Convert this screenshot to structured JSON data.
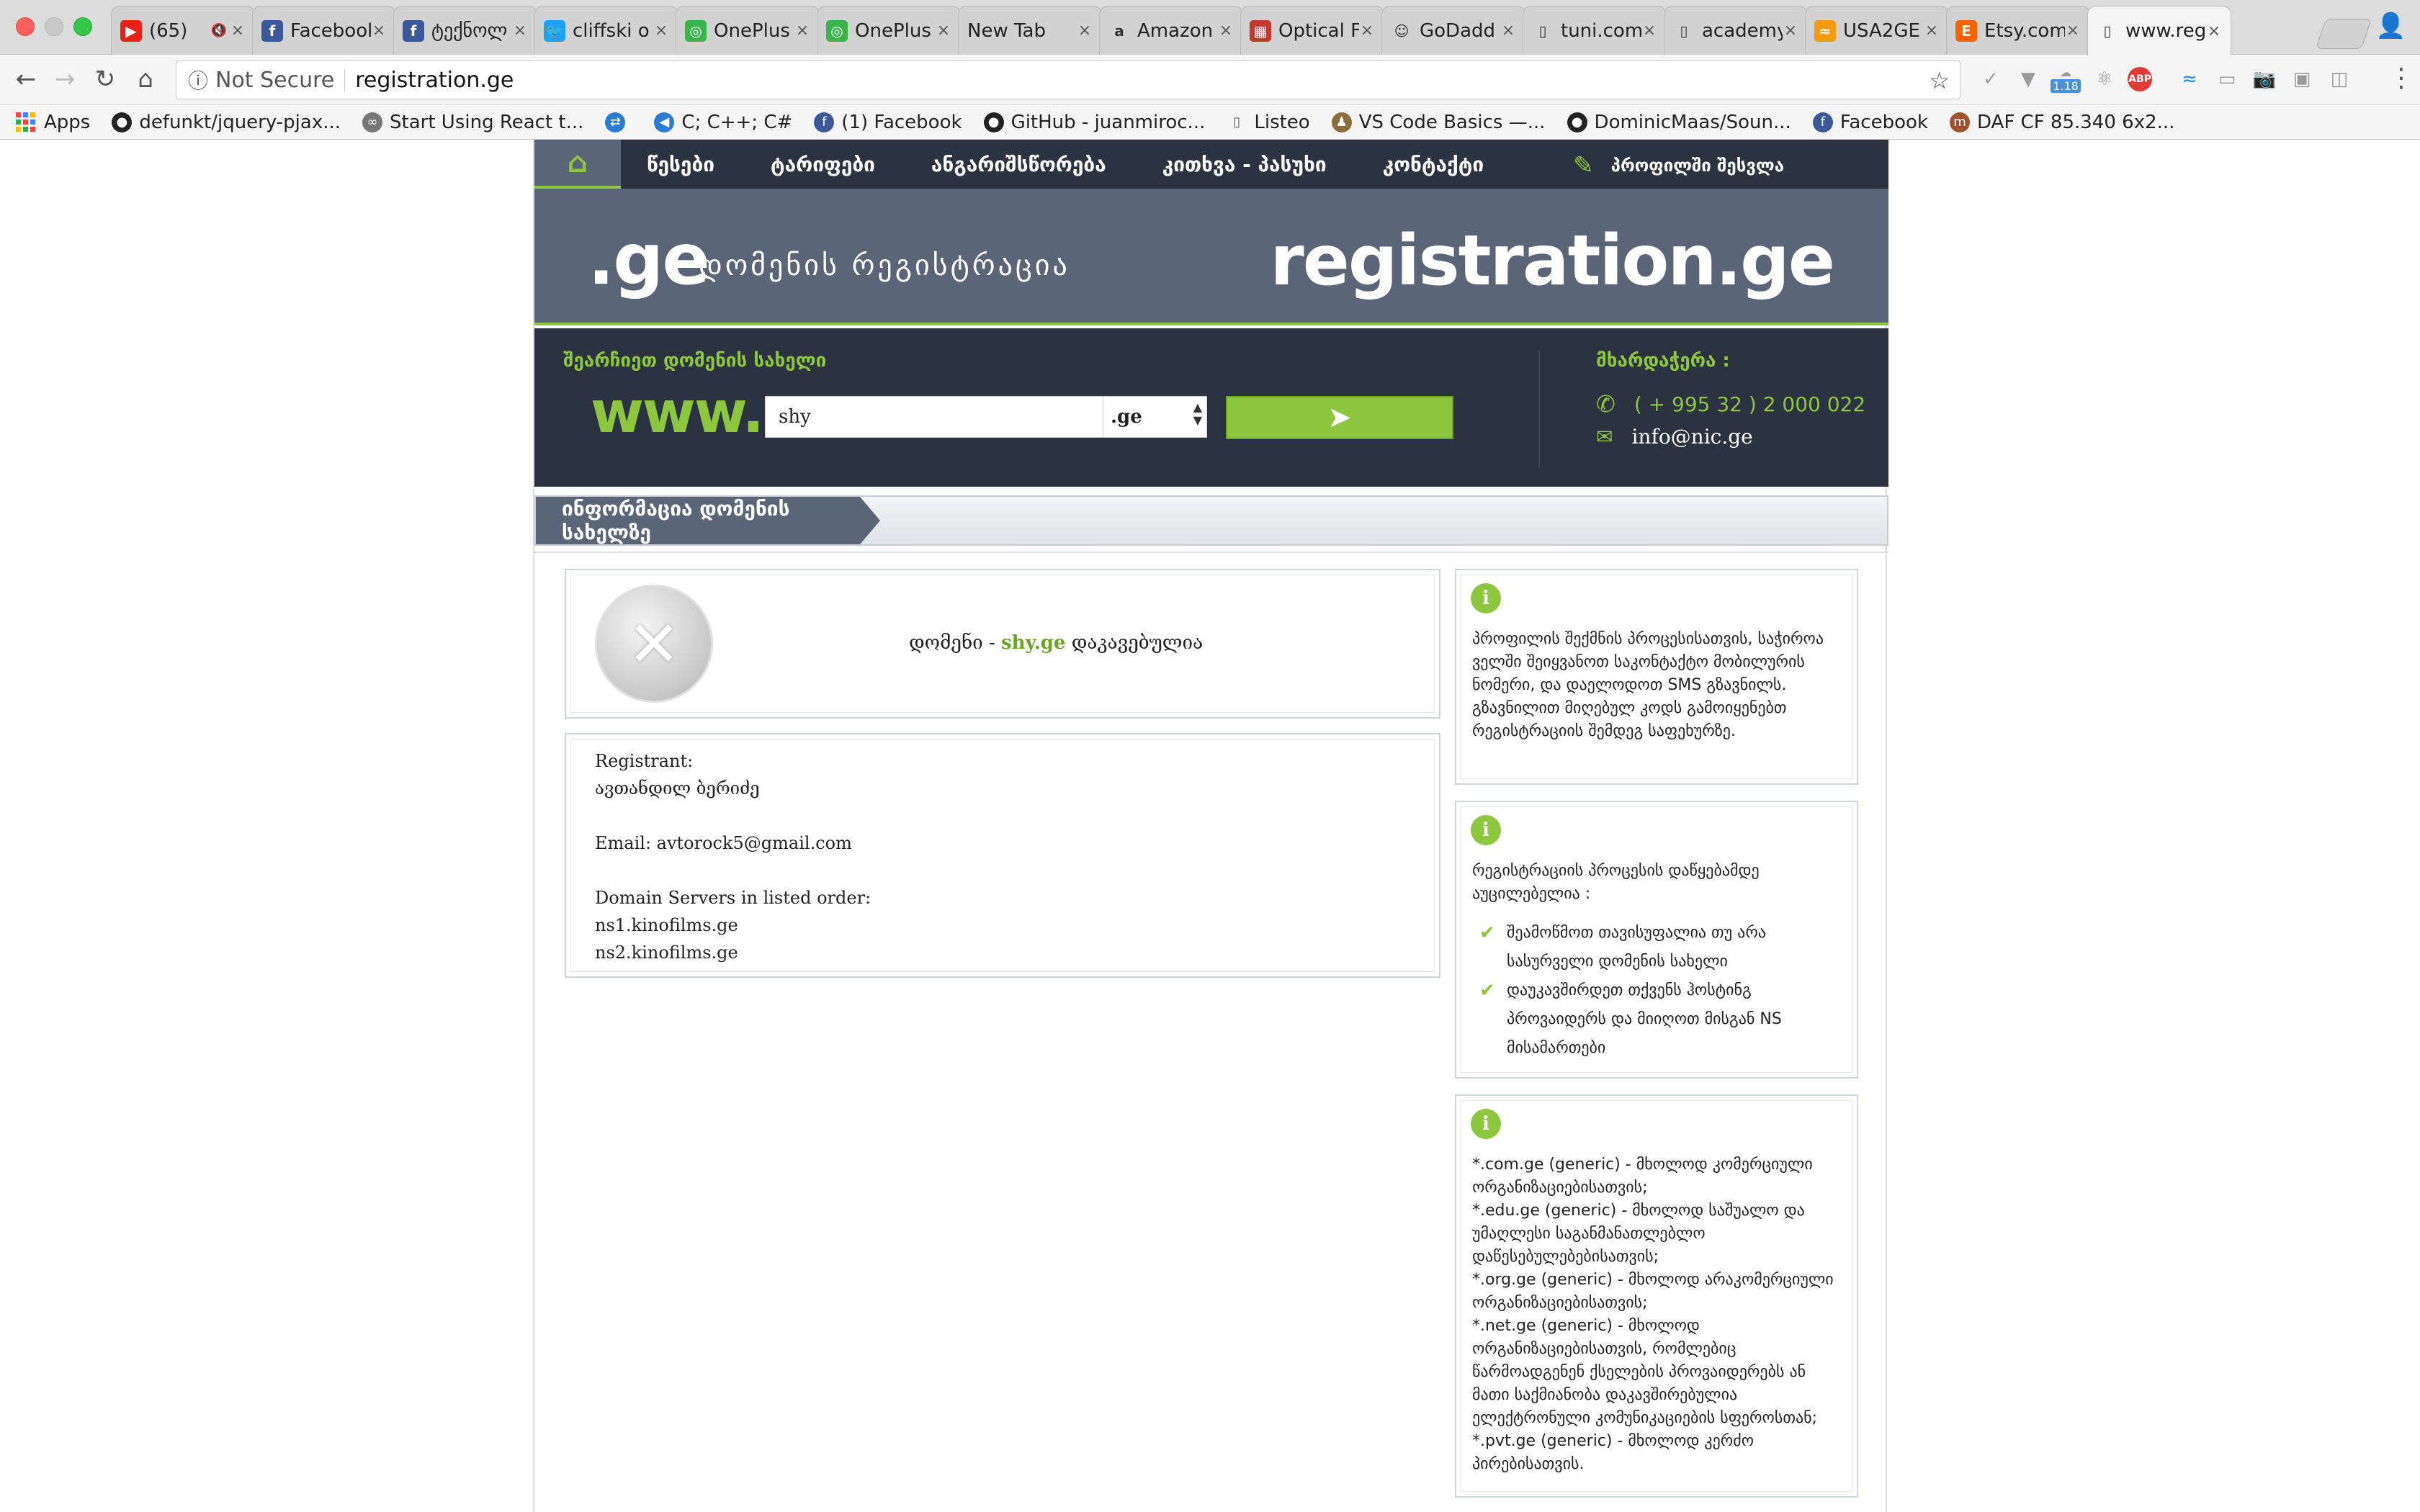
{
  "browser": {
    "tabs": [
      {
        "title": "(65)",
        "icon": "youtube-icon",
        "color": "#e62117",
        "glyph": "▶",
        "extra": "🔇"
      },
      {
        "title": "Facebook",
        "icon": "facebook-icon",
        "color": "#3b5998",
        "glyph": "f"
      },
      {
        "title": "ტექნოლ",
        "icon": "facebook-icon",
        "color": "#3b5998",
        "glyph": "f"
      },
      {
        "title": "cliffski o",
        "icon": "twitter-icon",
        "color": "#1da1f2",
        "glyph": "🐦"
      },
      {
        "title": "OnePlus",
        "icon": "oneplus-icon",
        "color": "#3ab54a",
        "glyph": "◎"
      },
      {
        "title": "OnePlus",
        "icon": "oneplus-icon",
        "color": "#3ab54a",
        "glyph": "◎"
      },
      {
        "title": "New Tab",
        "icon": "",
        "color": "",
        "glyph": ""
      },
      {
        "title": "Amazon",
        "icon": "amazon-icon",
        "color": "#fff",
        "glyph": "a"
      },
      {
        "title": "Optical F",
        "icon": "bag-icon",
        "color": "#c0392b",
        "glyph": "▦"
      },
      {
        "title": "GoDadd",
        "icon": "godaddy-icon",
        "color": "#fff",
        "glyph": "☺"
      },
      {
        "title": "tuni.com",
        "icon": "page-icon",
        "color": "#fff",
        "glyph": "▯"
      },
      {
        "title": "academy",
        "icon": "page-icon",
        "color": "#fff",
        "glyph": "▯"
      },
      {
        "title": "USA2GE",
        "icon": "usa2ge-icon",
        "color": "#f39c12",
        "glyph": "≈"
      },
      {
        "title": "Etsy.com",
        "icon": "etsy-icon",
        "color": "#f56400",
        "glyph": "E"
      },
      {
        "title": "www.reg",
        "icon": "page-icon",
        "color": "#fff",
        "glyph": "▯"
      }
    ],
    "not_secure": "Not Secure",
    "url": "registration.ge",
    "bookmarks": [
      {
        "label": "Apps",
        "icon": "apps-grid-icon"
      },
      {
        "label": "defunkt/jquery-pjax...",
        "icon": "github-icon"
      },
      {
        "label": "Start Using React t...",
        "icon": "glasses-icon"
      },
      {
        "label": "",
        "icon": "remote-icon"
      },
      {
        "label": "C; C++; C#",
        "icon": "vscode-icon"
      },
      {
        "label": "(1) Facebook",
        "icon": "facebook-icon"
      },
      {
        "label": "GitHub - juanmiroc...",
        "icon": "github-icon"
      },
      {
        "label": "Listeo",
        "icon": "page-icon"
      },
      {
        "label": "VS Code Basics —...",
        "icon": "figure-icon"
      },
      {
        "label": "DominicMaas/Soun...",
        "icon": "github-icon"
      },
      {
        "label": "Facebook",
        "icon": "facebook-icon"
      },
      {
        "label": "DAF CF 85.340 6x2...",
        "icon": "m-icon"
      }
    ],
    "extension_badge": "1.18"
  },
  "site": {
    "nav": {
      "items": [
        "წესები",
        "ტარიფები",
        "ანგარიშსწორება",
        "კითხვა - პასუხი",
        "კონტაქტი"
      ],
      "profile": "პროფილში შესვლა"
    },
    "banner": {
      "logo_tld": ".ge",
      "logo_sub": "დომენის რეგისტრაცია",
      "logo_big": "registration.ge"
    },
    "search": {
      "label": "შეარჩიეთ დომენის სახელი",
      "prefix": "www.",
      "value": "shy",
      "tld": ".ge"
    },
    "support": {
      "label": "მხარდაჭერა :",
      "phone": "( + 995 32 ) 2 000 022",
      "email": "info@nic.ge"
    },
    "section_title": "ინფორმაცია დომენის სახელზე",
    "status": {
      "prefix": "დომენი - ",
      "domain": "shy.ge",
      "suffix": " დაკავებულია"
    },
    "whois": {
      "registrant_label": "Registrant:",
      "registrant_name": "ავთანდილ ბერიძე",
      "email_line": "Email: avtorock5@gmail.com",
      "servers_label": "Domain Servers in listed order:",
      "servers": [
        "ns1.kinofilms.ge",
        "ns2.kinofilms.ge"
      ]
    },
    "info1": "პროფილის შექმნის პროცესისათვის, საჭიროა ველში შეიყვანოთ საკონტაქტო მობილურის ნომერი, და დაელოდოთ SMS გზავნილს. გზავნილით მიღებულ კოდს გამოიყენებთ რეგისტრაციის შემდეგ საფეხურზე.",
    "info2": {
      "intro": "რეგისტრაციის პროცესის დაწყებამდე აუცილებელია :",
      "items": [
        "შეამოწმოთ თავისუფალია თუ არა სასურველი დომენის სახელი",
        "დაუკავშირდეთ თქვენს ჰოსტინგ პროვაიდერს და მიიღოთ მისგან NS მისამართები"
      ]
    },
    "info3": [
      "*.com.ge (generic) - მხოლოდ კომერციული ორგანიზაციებისათვის;",
      "*.edu.ge (generic) - მხოლოდ საშუალო და უმაღლესი საგანმანათლებლო დაწესებულებებისათვის;",
      "*.org.ge (generic) - მხოლოდ არაკომერციული ორგანიზაციებისათვის;",
      "*.net.ge (generic) - მხოლოდ ორგანიზაციებისათვის, რომლებიც წარმოადგენენ ქსელების პროვაიდერებს ან მათი საქმიანობა დაკავშირებულია ელექტრონული კომუნიკაციების სფეროსთან;",
      "*.pvt.ge (generic) - მხოლოდ კერძო პირებისათვის."
    ]
  }
}
